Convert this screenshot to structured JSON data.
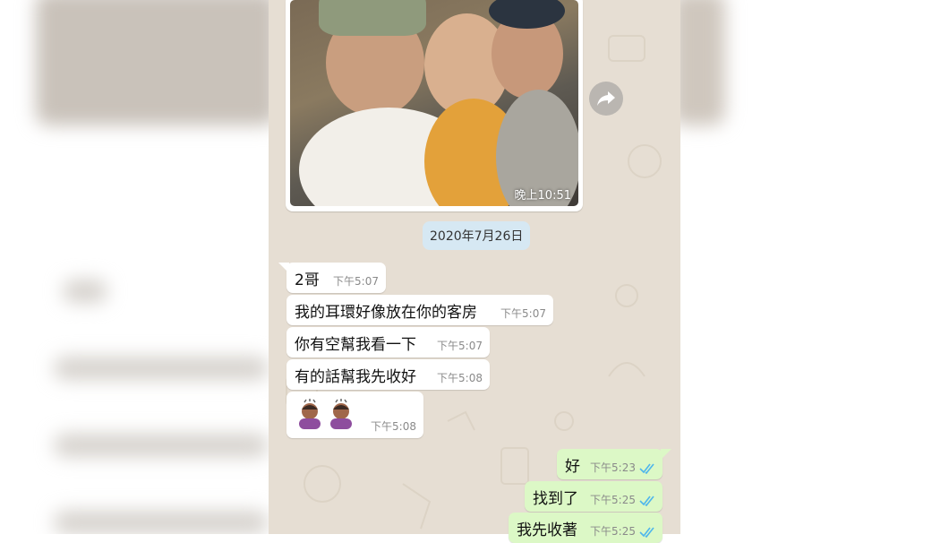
{
  "photo_message": {
    "time": "晚上10:51"
  },
  "date_divider": "2020年7月26日",
  "incoming": [
    {
      "text": "2哥",
      "time": "下午5:07"
    },
    {
      "text": "我的耳環好像放在你的客房",
      "time": "下午5:07"
    },
    {
      "text": "你有空幫我看一下",
      "time": "下午5:07"
    },
    {
      "text": "有的話幫我先收好",
      "time": "下午5:08"
    },
    {
      "text": "",
      "time": "下午5:08",
      "emoji": [
        "person-bowing-emoji",
        "person-bowing-emoji"
      ]
    }
  ],
  "outgoing": [
    {
      "text": "好",
      "time": "下午5:23",
      "status": "read"
    },
    {
      "text": "找到了",
      "time": "下午5:25",
      "status": "read"
    },
    {
      "text": "我先收著",
      "time": "下午5:25",
      "status": "read"
    }
  ],
  "colors": {
    "chat_bg": "#e6ded3",
    "incoming": "#ffffff",
    "outgoing": "#dcf8c6",
    "date_pill": "#d6e8f3",
    "read_tick": "#4fb6ec"
  }
}
